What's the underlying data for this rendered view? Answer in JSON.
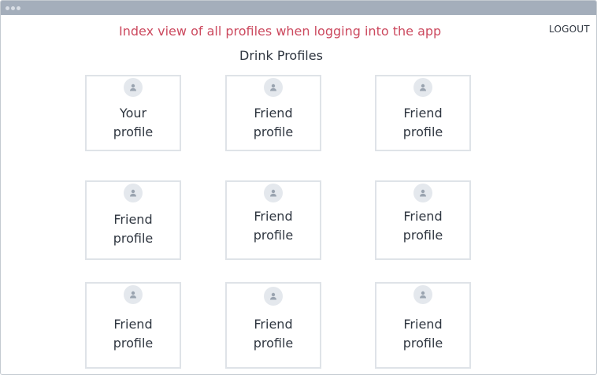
{
  "window": {
    "annotation": "Index view of all profiles when logging into the app",
    "logout_label": "LOGOUT"
  },
  "main": {
    "heading": "Drink Profiles",
    "cards": [
      {
        "label": "Your\nprofile",
        "avatar_icon": "user-avatar-icon"
      },
      {
        "label": "Friend\nprofile",
        "avatar_icon": "user-avatar-icon"
      },
      {
        "label": "Friend\nprofile",
        "avatar_icon": "user-avatar-icon"
      },
      {
        "label": "Friend\nprofile",
        "avatar_icon": "user-avatar-icon"
      },
      {
        "label": "Friend\nprofile",
        "avatar_icon": "user-avatar-icon"
      },
      {
        "label": "Friend\nprofile",
        "avatar_icon": "user-avatar-icon"
      },
      {
        "label": "Friend\nprofile",
        "avatar_icon": "user-avatar-icon"
      },
      {
        "label": "Friend\nprofile",
        "avatar_icon": "user-avatar-icon"
      },
      {
        "label": "Friend\nprofile",
        "avatar_icon": "user-avatar-icon"
      }
    ]
  },
  "colors": {
    "annotation": "#cc4a5f",
    "titlebar": "#a4aebb",
    "card_border": "#dfe3e8",
    "text": "#2f3640"
  }
}
